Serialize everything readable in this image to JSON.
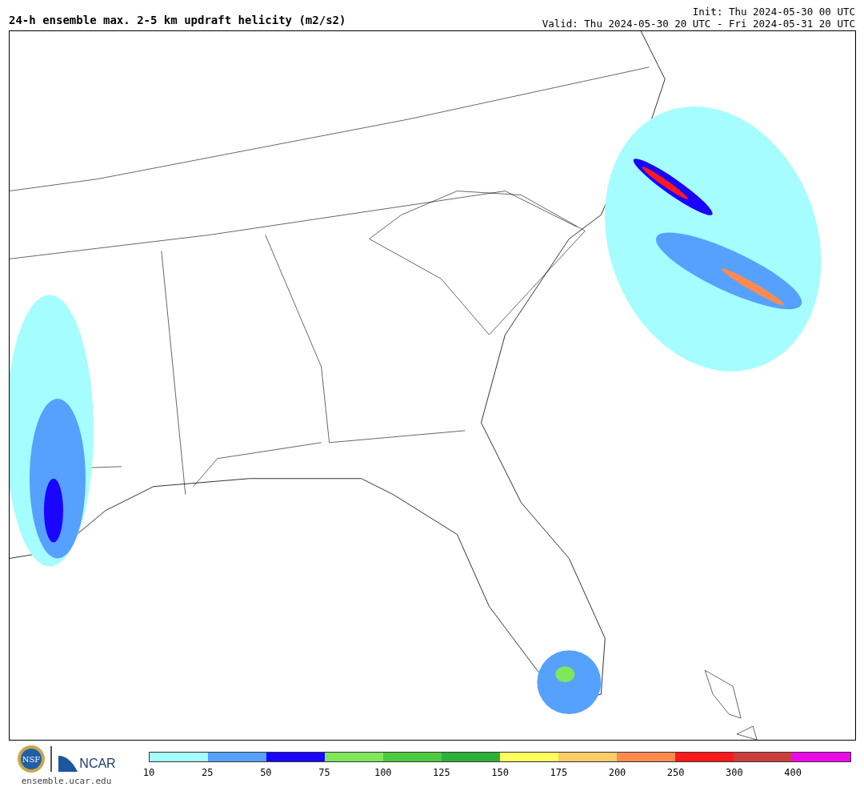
{
  "title": "24-h ensemble max. 2-5 km updraft helicity (m2/s2)",
  "init": "Init: Thu 2024-05-30 00 UTC",
  "valid": "Valid: Thu 2024-05-30 20 UTC - Fri 2024-05-31 20 UTC",
  "logos": {
    "nsf": "NSF",
    "ncar": "NCAR",
    "url": "ensemble.ucar.edu"
  },
  "colorbar": {
    "bins": [
      {
        "color": "#a6fdff"
      },
      {
        "color": "#55a1fd"
      },
      {
        "color": "#1a05fe"
      },
      {
        "color": "#80e65b"
      },
      {
        "color": "#4dca40"
      },
      {
        "color": "#2eb13a"
      },
      {
        "color": "#fefd5e"
      },
      {
        "color": "#fecc68"
      },
      {
        "color": "#fe8a4f"
      },
      {
        "color": "#fe1a1b"
      },
      {
        "color": "#cb3d3c"
      },
      {
        "color": "#ea0ae9"
      }
    ],
    "ticks": [
      "10",
      "25",
      "50",
      "75",
      "100",
      "125",
      "150",
      "175",
      "200",
      "250",
      "300",
      "400"
    ]
  }
}
